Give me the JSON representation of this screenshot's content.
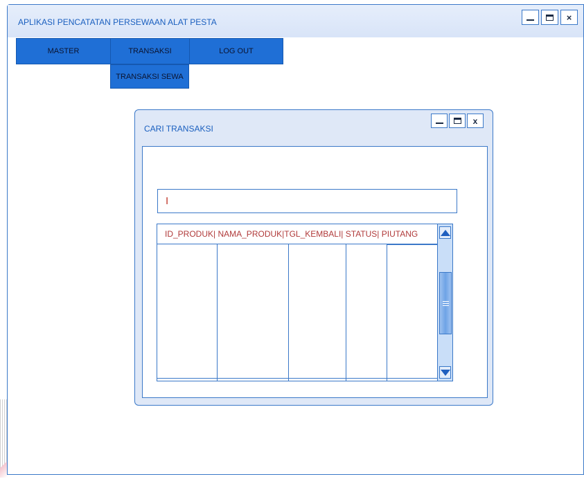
{
  "app": {
    "title": "APLIKASI PENCATATAN PERSEWAAN ALAT PESTA"
  },
  "window_controls": {
    "close": "×"
  },
  "menu": {
    "items": [
      {
        "label": "MASTER"
      },
      {
        "label": "TRANSAKSI"
      },
      {
        "label": "LOG OUT"
      }
    ],
    "submenu": {
      "label": "TRANSAKSI SEWA"
    }
  },
  "dialog": {
    "title": "CARI TRANSAKSI",
    "close": "x",
    "search": {
      "value": "I"
    },
    "table": {
      "columns": [
        "ID_PRODUK",
        "NAMA_PRODUK",
        "TGL_KEMBALI",
        "STATUS",
        "PIUTANG"
      ],
      "header_text": "ID_PRODUK| NAMA_PRODUK|TGL_KEMBALI| STATUS| PIUTANG",
      "rows": []
    }
  },
  "icons": {
    "minimize": "minimize-icon",
    "maximize": "maximize-icon",
    "close": "close-icon",
    "scroll_up": "arrow-up-icon",
    "scroll_down": "arrow-down-icon"
  },
  "colors": {
    "accent": "#1f6fd6",
    "border": "#3a78c8",
    "title_text": "#1a5fbf",
    "header_text": "#b03a3a"
  }
}
